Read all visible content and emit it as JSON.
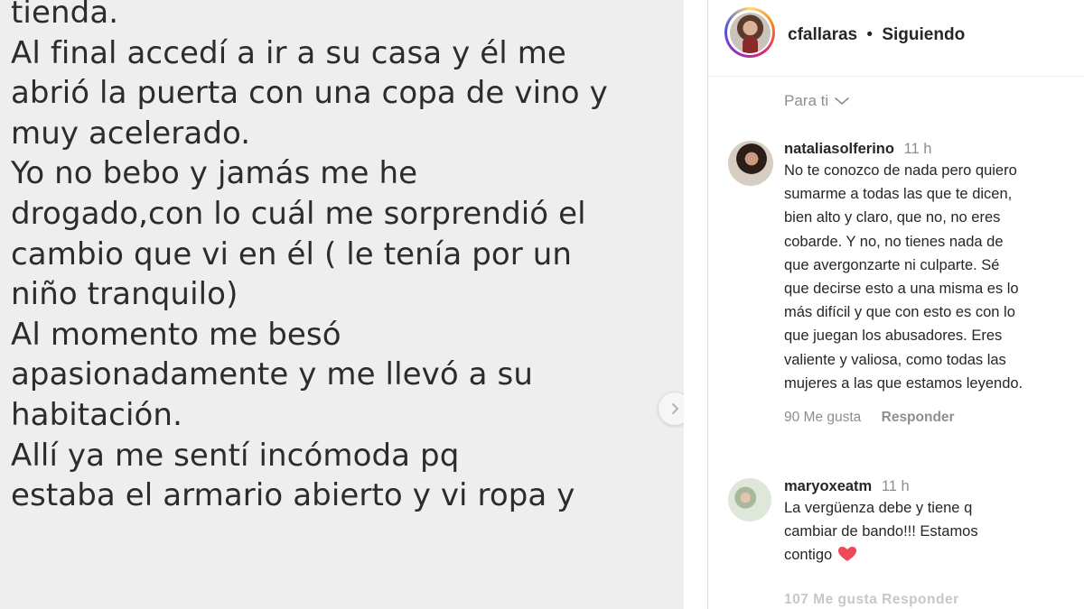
{
  "post": {
    "image_text_lines": [
      "tienda.",
      "Al final accedí a ir a su casa y él me",
      "abrió la puerta con una copa de vino y",
      "muy acelerado.",
      "Yo no bebo y jamás me he",
      "drogado,con lo cuál me sorprendió el",
      "cambio que vi en él ( le tenía por un",
      "niño tranquilo)",
      "Al momento me besó",
      "apasionadamente y me llevó a su",
      "habitación.",
      "Allí ya me sentí incómoda pq",
      "estaba el armario abierto y vi ropa y"
    ],
    "next_icon": "chevron-right-icon"
  },
  "header": {
    "username": "cfallaras",
    "separator": "•",
    "follow_status": "Siguiendo"
  },
  "feed_filter": {
    "label": "Para ti",
    "icon": "chevron-down-icon"
  },
  "comments": [
    {
      "username": "nataliasolferino",
      "time": "11 h",
      "text": "No te conozco de nada pero quiero\nsumarme a todas las que te dicen,\nbien alto y claro, que no, no eres\ncobarde. Y no, no tienes nada de\nque avergonzarte ni culparte. Sé\nque decirse esto a una misma es lo\nmás difícil y que con esto es con lo\nque juegan los abusadores. Eres\nvaliente y valiosa, como todas las\nmujeres a las que estamos leyendo.",
      "likes": "90 Me gusta",
      "reply": "Responder"
    },
    {
      "username": "maryoxeatm",
      "time": "11 h",
      "text": "La vergüenza debe y tiene q\ncambiar de bando!!! Estamos\ncontigo",
      "emoji": "red-heart-icon",
      "partial_meta": "107 Me gusta  Responder"
    }
  ],
  "colors": {
    "image_bg": "#eeeeee",
    "text_primary": "#262626",
    "text_secondary": "#8e8e8e",
    "heart": "#ed4956"
  }
}
